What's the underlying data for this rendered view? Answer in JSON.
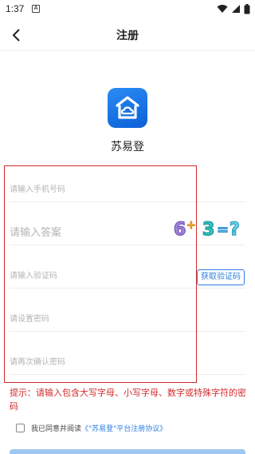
{
  "status_bar": {
    "time": "1:37",
    "notification_badge": "A",
    "icons": [
      "wifi-icon",
      "signal-icon",
      "battery-icon"
    ]
  },
  "nav": {
    "title": "注册",
    "back_icon": "chevron-left-icon"
  },
  "app": {
    "name": "苏易登",
    "logo_icon": "home-cloud-icon",
    "logo_color": "#1a74e8"
  },
  "form": {
    "phone_placeholder": "请输入手机号码",
    "answer_placeholder": "请输入答案",
    "code_placeholder": "请输入验证码",
    "get_code_label": "获取验证码",
    "password_placeholder": "请设置密码",
    "confirm_placeholder": "请再次确认密码"
  },
  "captcha": {
    "text": "6+3=?",
    "d1": "6",
    "op": "+",
    "d2": "3",
    "eq": "=",
    "q": "?"
  },
  "hint": "提示：请输入包含大写字母、小写字母、数字或特殊字符的密码",
  "agreement": {
    "prefix": "我已同意并阅读",
    "link": "《\"苏易登\"平台注册协议》"
  },
  "colors": {
    "accent": "#2f7fe0",
    "warning": "#d42b2b",
    "highlight_box": "#d42b2b"
  }
}
